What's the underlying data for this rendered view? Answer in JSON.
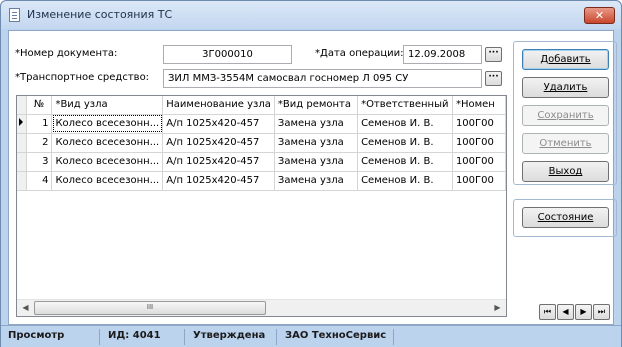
{
  "window": {
    "title": "Изменение состояния ТС",
    "close_label": "✕"
  },
  "form": {
    "doc_number_label": "*Номер документа:",
    "doc_number_value": "3Г000010",
    "op_date_label": "*Дата операции:",
    "op_date_value": "12.09.2008",
    "vehicle_label": "*Транспортное средство:",
    "vehicle_value": "ЗИЛ ММЗ-3554М самосвал госномер Л 095 СУ",
    "ellipsis": "···"
  },
  "grid": {
    "columns": [
      "№",
      "*Вид узла",
      "Наименование узла",
      "*Вид ремонта",
      "*Ответственный",
      "*Номен"
    ],
    "rows": [
      [
        "1",
        "Колесо всесезонн...",
        "А/п 1025х420-457",
        "Замена узла",
        "Семенов И. В.",
        "100Г00"
      ],
      [
        "2",
        "Колесо всесезонн...",
        "А/п 1025х420-457",
        "Замена узла",
        "Семенов И. В.",
        "100Г00"
      ],
      [
        "3",
        "Колесо всесезонн...",
        "А/п 1025х420-457",
        "Замена узла",
        "Семенов И. В.",
        "100Г00"
      ],
      [
        "4",
        "Колесо всесезонн...",
        "А/п 1025х420-457",
        "Замена узла",
        "Семенов И. В.",
        "100Г00"
      ]
    ],
    "scroll_thumb_label": "III"
  },
  "buttons": {
    "add": "Добавить",
    "delete": "Удалить",
    "save": "Сохранить",
    "cancel": "Отменить",
    "exit": "Выход",
    "state": "Состояние"
  },
  "nav": {
    "first": "⏮",
    "prev": "◀",
    "next": "▶",
    "last": "⏭"
  },
  "status": {
    "mode": "Просмотр",
    "id": "ИД: 4041",
    "state": "Утверждена",
    "company": "ЗАО ТехноСервис"
  },
  "colors": {
    "window_bg": "#bcd3ee",
    "close_button": "#c9462c"
  }
}
